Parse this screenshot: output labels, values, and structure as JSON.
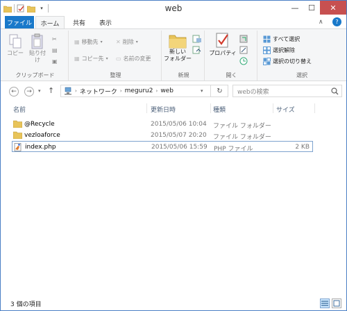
{
  "window": {
    "title": "web"
  },
  "tabs": {
    "file": "ファイル",
    "home": "ホーム",
    "share": "共有",
    "view": "表示"
  },
  "ribbon": {
    "clipboard": {
      "label": "クリップボード",
      "copy": "コピー",
      "paste": "貼り付け"
    },
    "organize": {
      "label": "整理",
      "move_to": "移動先",
      "copy_to": "コピー先",
      "delete": "削除",
      "rename": "名前の変更"
    },
    "new": {
      "label": "新規",
      "new_folder": "新しい\nフォルダー"
    },
    "open": {
      "label": "開く",
      "properties": "プロパティ"
    },
    "select": {
      "label": "選択",
      "select_all": "すべて選択",
      "select_none": "選択解除",
      "invert": "選択の切り替え"
    }
  },
  "address": {
    "segments": [
      "ネットワーク",
      "meguru2",
      "web"
    ],
    "search_placeholder": "webの検索"
  },
  "columns": {
    "name": "名前",
    "date": "更新日時",
    "type": "種類",
    "size": "サイズ"
  },
  "files": [
    {
      "name": "@Recycle",
      "date": "2015/05/06 10:04",
      "type": "ファイル フォルダー",
      "size": "",
      "icon": "folder-icon"
    },
    {
      "name": "vezloaforce",
      "date": "2015/05/07 20:20",
      "type": "ファイル フォルダー",
      "size": "",
      "icon": "folder-icon"
    },
    {
      "name": "index.php",
      "date": "2015/05/06 15:59",
      "type": "PHP ファイル",
      "size": "2 KB",
      "icon": "php-file-icon"
    }
  ],
  "status": {
    "count": "3 個の項目"
  },
  "colors": {
    "accent": "#1979ca",
    "close": "#c75050",
    "folder": "#e8c45a"
  }
}
